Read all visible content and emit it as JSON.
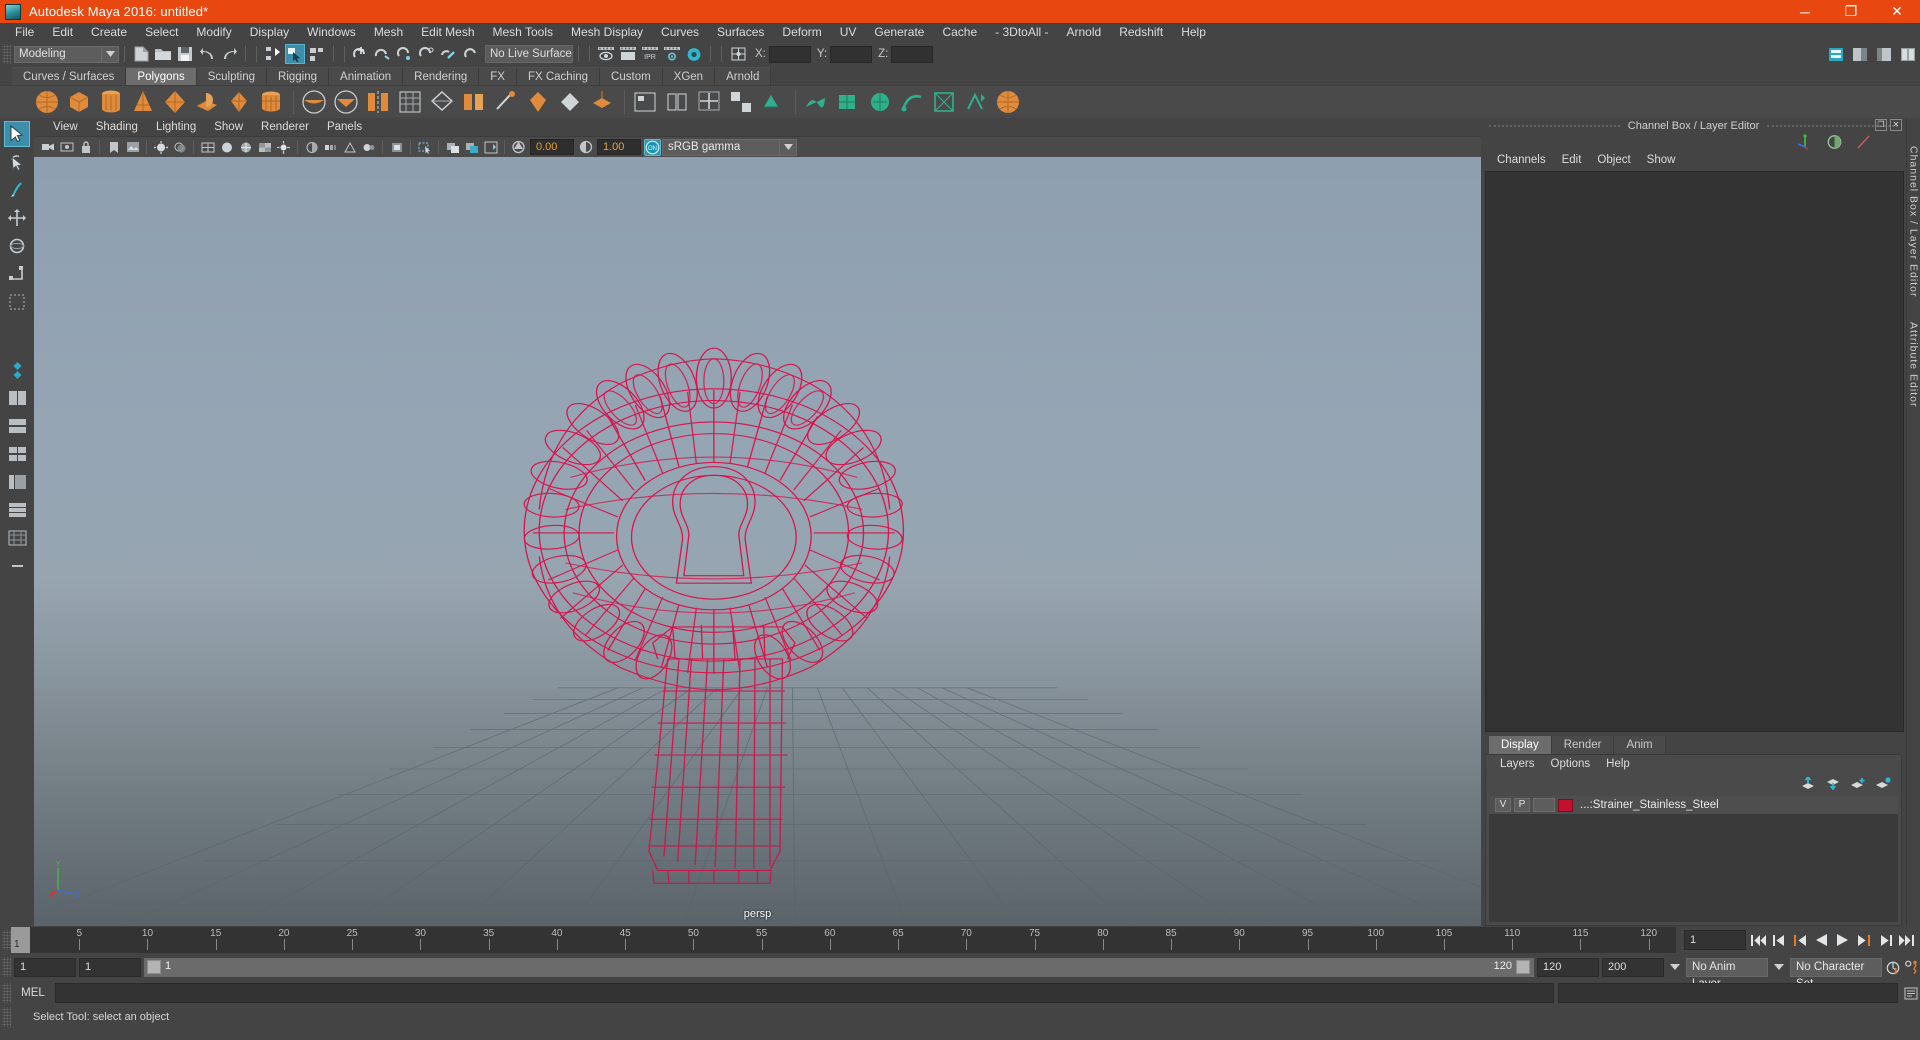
{
  "window": {
    "title": "Autodesk Maya 2016: untitled*",
    "logo_icon": "maya-logo-icon",
    "minimize_label": "─",
    "maximize_label": "❐",
    "close_label": "✕",
    "accent_color": "#e8470f",
    "background_color": "#444444"
  },
  "menubar": {
    "items": [
      "File",
      "Edit",
      "Create",
      "Select",
      "Modify",
      "Display",
      "Windows",
      "Mesh",
      "Edit Mesh",
      "Mesh Tools",
      "Mesh Display",
      "Curves",
      "Surfaces",
      "Deform",
      "UV",
      "Generate",
      "Cache",
      "- 3DtoAll -",
      "Arnold",
      "Redshift",
      "Help"
    ]
  },
  "statusbar": {
    "mode": "Modeling",
    "live_surface": "No Live Surface",
    "coord_x_label": "X:",
    "coord_y_label": "Y:",
    "coord_z_label": "Z:",
    "coord_x_value": "",
    "coord_y_value": "",
    "coord_z_value": "",
    "icons": [
      "new-scene-icon",
      "open-scene-icon",
      "save-scene-icon",
      "undo-icon",
      "redo-icon",
      "select-hierarchy-icon",
      "select-object-icon",
      "select-component-icon",
      "snap-grid-icon",
      "snap-curve-icon",
      "snap-point-icon",
      "snap-projected-icon",
      "snap-view-plane-icon",
      "make-live-icon",
      "render-view-icon",
      "render-region-icon",
      "ipr-render-icon",
      "render-settings-icon",
      "hypershade-icon",
      "editor-toggle-icon"
    ],
    "right_icons": [
      "show-manipulator-icon",
      "channel-box-icon",
      "attribute-editor-icon",
      "tool-settings-icon"
    ]
  },
  "shelf": {
    "tabs": [
      {
        "label": "Curves / Surfaces",
        "active": false
      },
      {
        "label": "Polygons",
        "active": true
      },
      {
        "label": "Sculpting",
        "active": false
      },
      {
        "label": "Rigging",
        "active": false
      },
      {
        "label": "Animation",
        "active": false
      },
      {
        "label": "Rendering",
        "active": false
      },
      {
        "label": "FX",
        "active": false
      },
      {
        "label": "FX Caching",
        "active": false
      },
      {
        "label": "Custom",
        "active": false
      },
      {
        "label": "XGen",
        "active": false
      },
      {
        "label": "Arnold",
        "active": false
      }
    ],
    "icons": [
      "poly-sphere-icon",
      "poly-cube-icon",
      "poly-cylinder-icon",
      "poly-cone-icon",
      "poly-torus-icon",
      "poly-plane-icon",
      "poly-pyramid-icon",
      "poly-prism-icon",
      "poly-booleans-union-icon",
      "poly-booleans-difference-icon",
      "poly-combine-icon",
      "poly-separate-icon",
      "poly-smooth-icon",
      "poly-extrude-icon",
      "poly-bevel-icon",
      "poly-bridge-icon",
      "append-polygon-icon",
      "poly-wedge-icon",
      "poly-mirror-icon",
      "poly-cut-icon",
      "multi-cut-icon",
      "target-weld-icon",
      "quad-draw-icon",
      "uv-planar-icon",
      "uv-cylindrical-icon",
      "uv-spherical-icon",
      "uv-automatic-icon",
      "uv-editor-icon",
      "uv-layout-icon",
      "uv-cut-icon"
    ]
  },
  "toolbox": {
    "tools": [
      {
        "name": "select-tool",
        "selected": true
      },
      {
        "name": "lasso-select-tool",
        "selected": false
      },
      {
        "name": "paint-select-tool",
        "selected": false
      },
      {
        "name": "move-tool",
        "selected": false
      },
      {
        "name": "rotate-tool",
        "selected": false
      },
      {
        "name": "scale-tool",
        "selected": false
      },
      {
        "name": "last-tool-used",
        "selected": false
      },
      {
        "name": "snap-toggle-icon",
        "selected": false
      },
      {
        "name": "layout-single-pane-icon",
        "selected": false
      },
      {
        "name": "layout-two-pane-side-icon",
        "selected": false
      },
      {
        "name": "layout-two-pane-stacked-icon",
        "selected": false
      },
      {
        "name": "layout-four-pane-icon",
        "selected": false
      },
      {
        "name": "layout-hypergraph-icon",
        "selected": false
      },
      {
        "name": "layout-outliner-icon",
        "selected": false
      },
      {
        "name": "layout-expand-icon",
        "selected": false
      }
    ]
  },
  "viewport": {
    "menus": [
      "View",
      "Shading",
      "Lighting",
      "Show",
      "Renderer",
      "Panels"
    ],
    "camera_label": "persp",
    "exposure_value": "0.00",
    "gamma_value": "1.00",
    "color_management": "sRGB gamma",
    "color_management_toggle": "ON",
    "axis_labels": {
      "y": "Y",
      "x": "X",
      "z": "Z"
    },
    "mesh_color": "#d9114a",
    "toolbar_icons": [
      "select-camera-icon",
      "lock-camera-icon",
      "camera-attributes-icon",
      "bookmark-icon",
      "image-plane-icon",
      "two-sided-lighting-icon",
      "wireframe-icon",
      "smooth-shade-icon",
      "shaded-wireframe-icon",
      "textured-icon",
      "lights-icon",
      "shadows-icon",
      "screen-space-ao-icon",
      "motion-blur-icon",
      "multisample-aa-icon",
      "depth-of-field-icon",
      "isolate-select-icon",
      "xray-icon",
      "xray-joints-icon",
      "xray-active-components-icon",
      "exposure-icon",
      "gamma-icon",
      "color-management-toggle-icon"
    ]
  },
  "right_panel": {
    "title": "Channel Box / Layer Editor",
    "restore_label": "❐",
    "close_label": "✕",
    "channelbox_menus": [
      "Channels",
      "Edit",
      "Object",
      "Show"
    ],
    "channelbox_icons": [
      "transform-axes-icon",
      "half-circle-icon",
      "slash-icon"
    ],
    "layer_tabs": [
      {
        "label": "Display",
        "active": true
      },
      {
        "label": "Render",
        "active": false
      },
      {
        "label": "Anim",
        "active": false
      }
    ],
    "layer_menus": [
      "Layers",
      "Options",
      "Help"
    ],
    "layer_buttons": [
      "move-layer-up-icon",
      "move-layer-down-icon",
      "new-layer-icon",
      "new-layer-from-selected-icon"
    ],
    "layers": [
      {
        "visibility": "V",
        "playback": "P",
        "shading": "",
        "color": "#c3102e",
        "name": "...:Strainer_Stainless_Steel"
      }
    ],
    "dock_labels": [
      "Channel Box / Layer Editor",
      "Attribute Editor"
    ]
  },
  "timeline": {
    "ticks": [
      5,
      10,
      15,
      20,
      25,
      30,
      35,
      40,
      45,
      50,
      55,
      60,
      65,
      70,
      75,
      80,
      85,
      90,
      95,
      100,
      105,
      110,
      115,
      120
    ],
    "current_frame": "1",
    "current_frame_field": "1",
    "playback_buttons": [
      "go-to-start-icon",
      "step-back-frame-icon",
      "step-back-key-icon",
      "play-backwards-icon",
      "play-forwards-icon",
      "step-forward-key-icon",
      "step-forward-frame-icon",
      "go-to-end-icon"
    ]
  },
  "range": {
    "anim_start": "1",
    "range_start": "1",
    "slider_start_label": "1",
    "slider_end_label": "120",
    "range_end": "120",
    "anim_end": "200",
    "anim_layer": "No Anim Layer",
    "character_set": "No Character Set",
    "auto_key_icon": "auto-keyframe-icon",
    "prefs_icon": "animation-preferences-icon"
  },
  "command_line": {
    "language_label": "MEL",
    "input_value": "",
    "placeholder": ""
  },
  "help_line": {
    "text": "Select Tool: select an object"
  }
}
